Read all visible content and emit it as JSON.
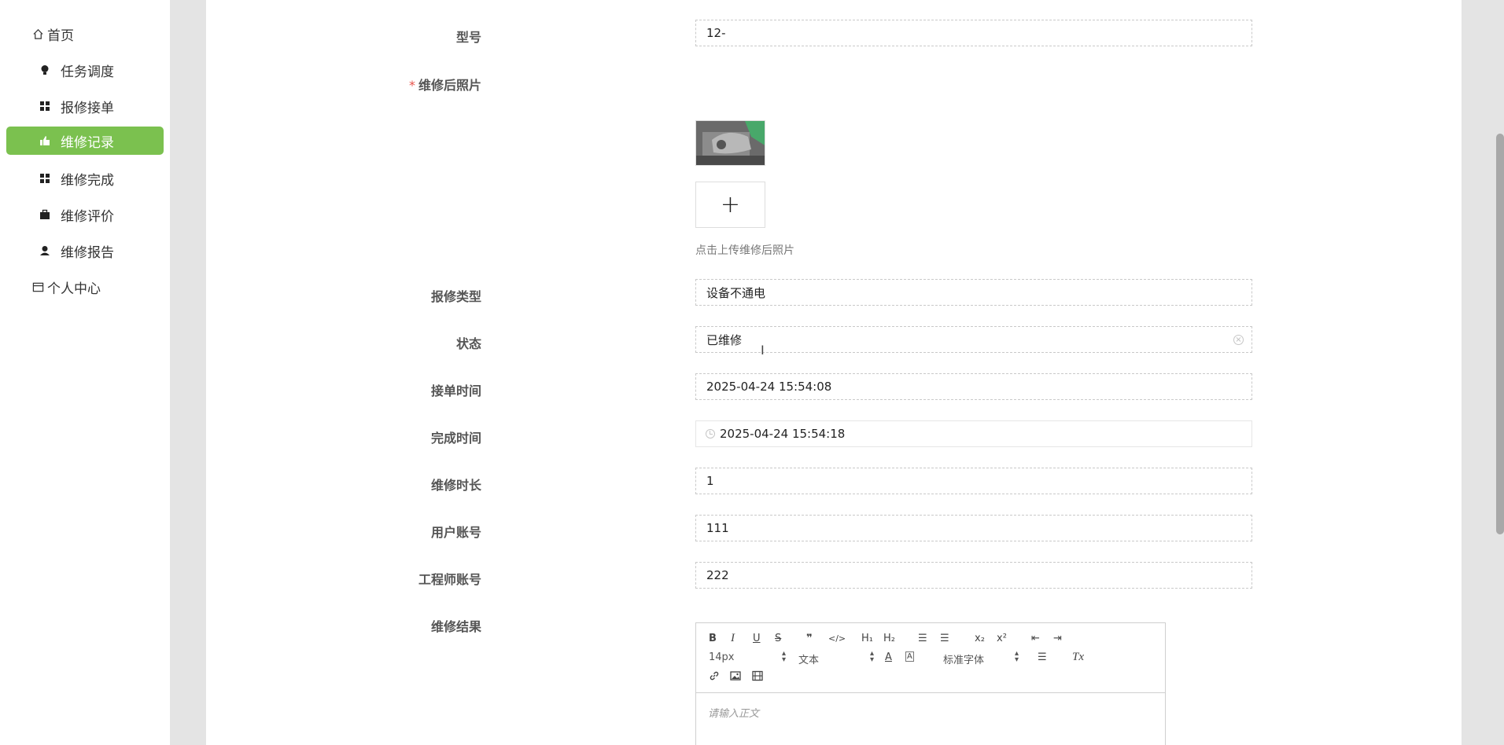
{
  "sidebar": {
    "home": "首页",
    "items": [
      {
        "label": "任务调度"
      },
      {
        "label": "报修接单"
      },
      {
        "label": "维修记录"
      },
      {
        "label": "维修完成"
      },
      {
        "label": "维修评价"
      },
      {
        "label": "维修报告"
      }
    ],
    "personal": "个人中心"
  },
  "form": {
    "model": {
      "label": "型号",
      "value": "12-"
    },
    "photo": {
      "label": "维修后照片",
      "required_mark": "*",
      "upload_plus": "+",
      "hint": "点击上传维修后照片"
    },
    "repair_type": {
      "label": "报修类型",
      "value": "设备不通电"
    },
    "status": {
      "label": "状态",
      "value": "已维修"
    },
    "accept_time": {
      "label": "接单时间",
      "value": "2025-04-24 15:54:08"
    },
    "finish_time": {
      "label": "完成时间",
      "value": "2025-04-24 15:54:18"
    },
    "duration": {
      "label": "维修时长",
      "value": "1"
    },
    "user_account": {
      "label": "用户账号",
      "value": "111"
    },
    "engineer_account": {
      "label": "工程师账号",
      "value": "222"
    },
    "result": {
      "label": "维修结果",
      "placeholder": "请输入正文"
    }
  },
  "editor": {
    "font_size": "14px",
    "paragraph": "文本",
    "font_family": "标准字体",
    "buttons": {
      "bold": "B",
      "italic": "I",
      "underline": "U",
      "strike": "S",
      "quote": "❞",
      "code": "</>",
      "h1": "H₁",
      "h2": "H₂",
      "ordered": "☰",
      "bullet": "☰",
      "sub": "x₂",
      "sup": "x²",
      "outdent": "⇤",
      "indent": "⇥",
      "color": "A",
      "bg": "A",
      "align": "☰",
      "clean": "Tx"
    }
  },
  "colors": {
    "accent": "#7bc14f",
    "required": "#e8534b"
  }
}
